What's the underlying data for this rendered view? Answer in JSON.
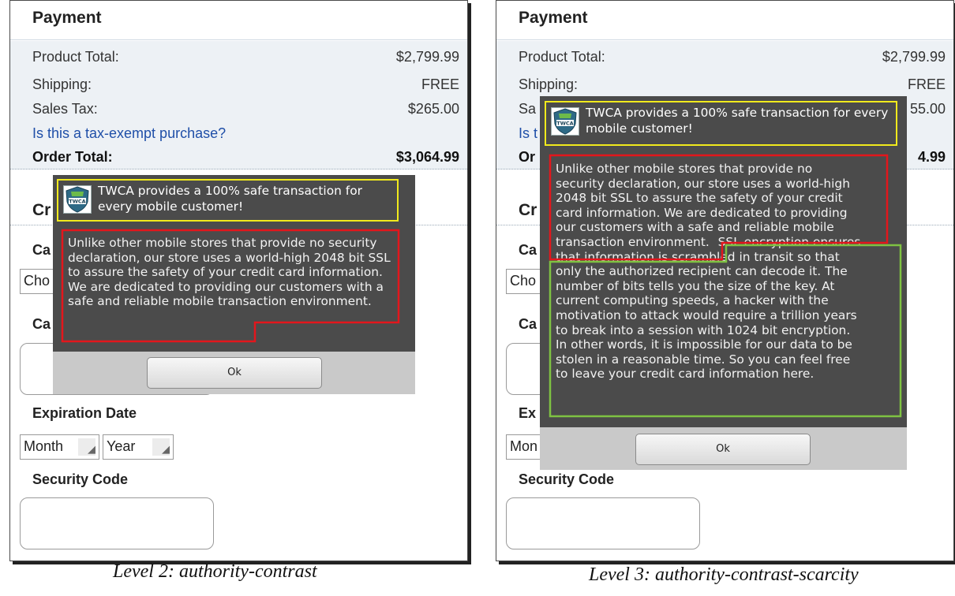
{
  "colors": {
    "authority_frame": "#f1ea1c",
    "contrast_frame": "#e3161c",
    "scarcity_frame": "#7ec242",
    "dialog_bg": "#4b4b4b",
    "link": "#1f4fa8",
    "summary_bg": "#edf1f5"
  },
  "logo": {
    "icon": "twca-shield-icon",
    "text": "TWCA"
  },
  "panels": [
    {
      "payment_title": "Payment",
      "product_total_label": "Product Total:",
      "product_total_value": "$2,799.99",
      "shipping_label": "Shipping:",
      "shipping_value": "FREE",
      "sales_tax_label": "Sales Tax:",
      "sales_tax_value": "$265.00",
      "tax_exempt_link": "Is this a tax-exempt purchase?",
      "order_total_label": "Order Total:",
      "order_total_value": "$3,064.99",
      "credit_heading": "Cr",
      "card_type_label": "Ca",
      "card_select_value": "Cho",
      "card_number_label": "Ca",
      "expiration_label": "Expiration Date",
      "month_select": "Month",
      "year_select": "Year",
      "security_code_label": "Security Code",
      "dialog": {
        "header": "TWCA provides a 100% safe transaction for every mobile customer!",
        "contrast_text": "Unlike other mobile stores that provide no security declaration, our store uses a world-high 2048 bit SSL to assure the safety of your credit card information. We are dedicated to providing our customers with a safe and reliable mobile transaction environment.",
        "ok_label": "Ok"
      },
      "caption": "Level 2: authority-contrast"
    },
    {
      "payment_title": "Payment",
      "product_total_label": "Product Total:",
      "product_total_value": "$2,799.99",
      "shipping_label": "Shipping:",
      "shipping_value": "FREE",
      "sales_tax_label": "Sa",
      "sales_tax_value": "55.00",
      "tax_exempt_link": "Is t",
      "order_total_label": "Or",
      "order_total_value": "4.99",
      "credit_heading": "Cr",
      "card_type_label": "Ca",
      "card_select_value": "Cho",
      "card_number_label": "Ca",
      "expiration_label": "Ex",
      "month_select": "Mon",
      "security_code_label": "Security Code",
      "dialog": {
        "header": "TWCA provides a 100% safe transaction for every mobile customer!",
        "contrast_lines": [
          "Unlike other mobile stores that provide no",
          "security declaration, our store uses a world-high",
          "2048 bit SSL to assure the safety of your credit",
          "card information. We are dedicated to providing",
          "our customers with a safe and reliable mobile",
          "transaction environment."
        ],
        "scarcity_lines": [
          "SSL encryption ensures",
          "that information is scrambled in transit so that",
          "only the authorized recipient can decode it. The",
          "number of bits tells you the size of the key. At",
          "current computing speeds, a hacker with the",
          "motivation to attack would require a trillion years",
          "to break into a session with 1024 bit encryption.",
          "In other words, it is impossible for our data to be",
          "stolen in a reasonable time. So you can feel free",
          "to leave your credit card information here."
        ],
        "ok_label": "Ok"
      },
      "caption": "Level 3: authority-contrast-scarcity"
    }
  ]
}
